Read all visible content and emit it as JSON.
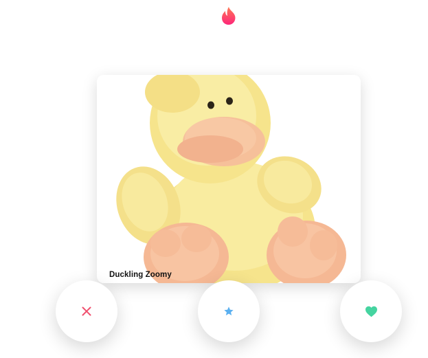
{
  "app": {
    "logo_icon": "flame-icon",
    "logo_gradient": [
      "#ff6b6b",
      "#fd267a"
    ]
  },
  "card": {
    "name": "Duckling Zoomy",
    "photo_subject": "yellow-duck-plush"
  },
  "actions": {
    "nope": {
      "icon": "close-icon",
      "color": "#f0506e"
    },
    "super_like": {
      "icon": "star-icon",
      "color": "#5bb0f0"
    },
    "like": {
      "icon": "heart-icon",
      "color": "#45d4a0"
    }
  }
}
